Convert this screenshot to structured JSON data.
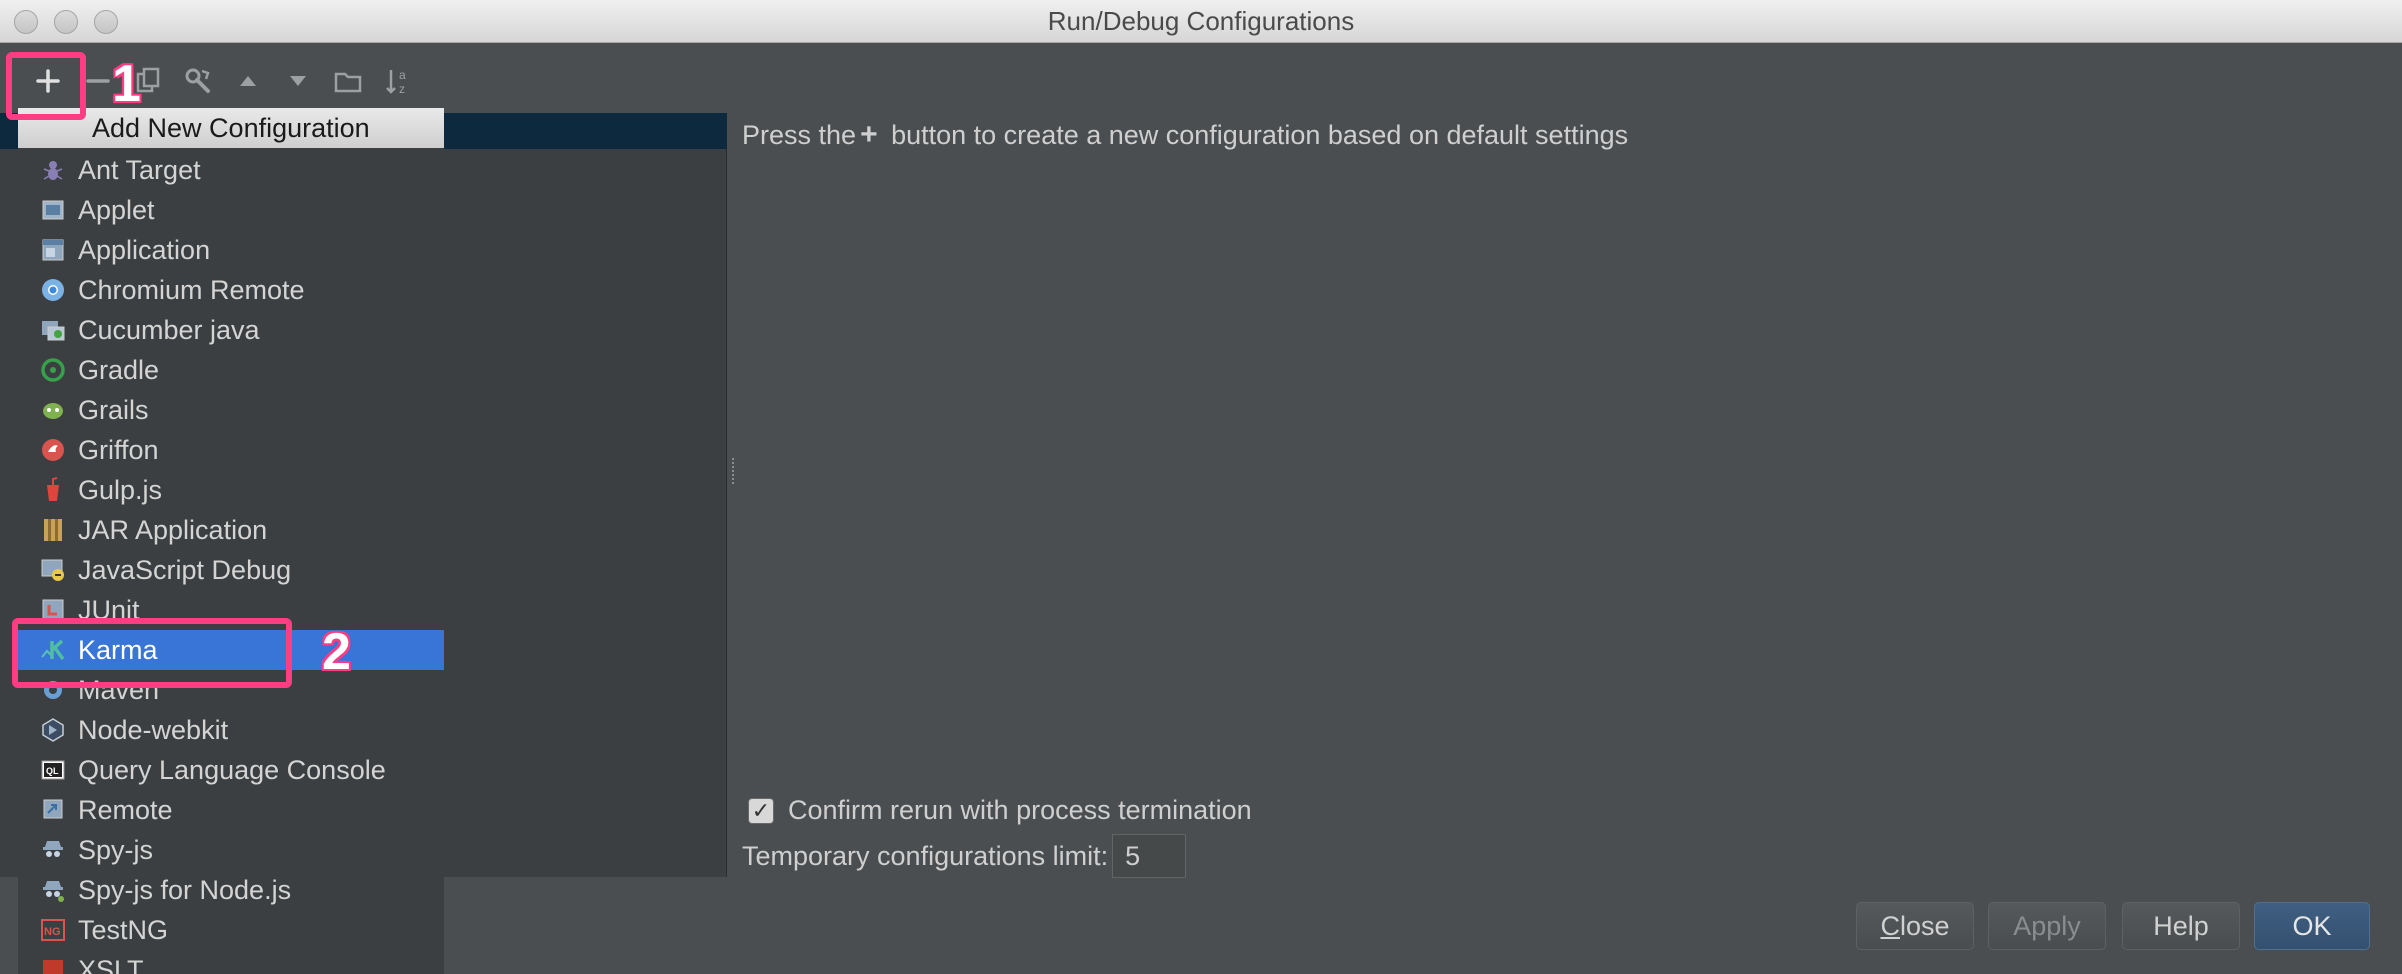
{
  "window": {
    "title": "Run/Debug Configurations"
  },
  "toolbar": {
    "icons": [
      "add-icon",
      "remove-icon",
      "copy-icon",
      "wrench-icon",
      "move-up-icon",
      "move-down-icon",
      "folder-icon",
      "sort-icon"
    ]
  },
  "popup": {
    "header": "Add New Configuration",
    "items": [
      {
        "label": "Ant Target",
        "icon": "ant-icon"
      },
      {
        "label": "Applet",
        "icon": "applet-icon"
      },
      {
        "label": "Application",
        "icon": "application-icon"
      },
      {
        "label": "Chromium Remote",
        "icon": "chromium-icon"
      },
      {
        "label": "Cucumber java",
        "icon": "cucumber-icon"
      },
      {
        "label": "Gradle",
        "icon": "gradle-icon"
      },
      {
        "label": "Grails",
        "icon": "grails-icon"
      },
      {
        "label": "Griffon",
        "icon": "griffon-icon"
      },
      {
        "label": "Gulp.js",
        "icon": "gulp-icon"
      },
      {
        "label": "JAR Application",
        "icon": "jar-icon"
      },
      {
        "label": "JavaScript Debug",
        "icon": "javascript-debug-icon"
      },
      {
        "label": "JUnit",
        "icon": "junit-icon"
      },
      {
        "label": "Karma",
        "icon": "karma-icon",
        "selected": true
      },
      {
        "label": "Maven",
        "icon": "maven-icon"
      },
      {
        "label": "Node-webkit",
        "icon": "node-webkit-icon"
      },
      {
        "label": "Query Language Console",
        "icon": "ql-console-icon"
      },
      {
        "label": "Remote",
        "icon": "remote-icon"
      },
      {
        "label": "Spy-js",
        "icon": "spy-js-icon"
      },
      {
        "label": "Spy-js for Node.js",
        "icon": "spy-js-node-icon"
      },
      {
        "label": "TestNG",
        "icon": "testng-icon"
      },
      {
        "label": "XSLT",
        "icon": "xslt-icon"
      }
    ]
  },
  "main": {
    "hint_before": "Press the",
    "hint_plus": "+",
    "hint_after": " button to create a new configuration based on default settings",
    "confirm_label": "Confirm rerun with process termination",
    "confirm_checked": true,
    "limit_label": "Temporary configurations limit:",
    "limit_value": "5"
  },
  "buttons": {
    "close_pre": "",
    "close_u": "C",
    "close_post": "lose",
    "apply": "Apply",
    "help": "Help",
    "ok": "OK"
  },
  "annotations": {
    "one": "1",
    "two": "2",
    "color": "#ff3d83"
  }
}
